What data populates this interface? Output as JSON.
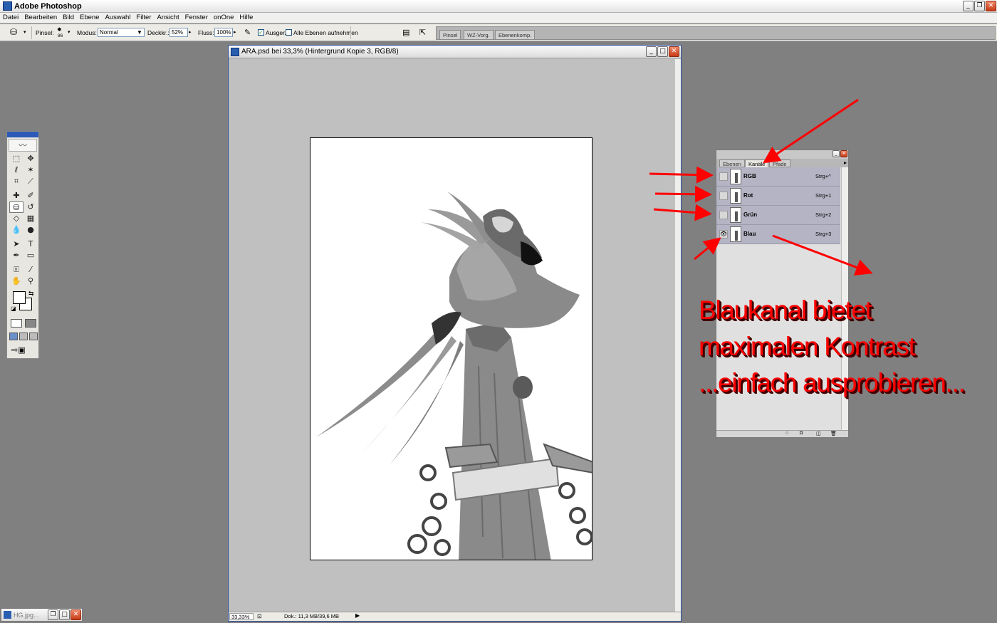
{
  "app": {
    "title": "Adobe Photoshop"
  },
  "menu": [
    "Datei",
    "Bearbeiten",
    "Bild",
    "Ebene",
    "Auswahl",
    "Filter",
    "Ansicht",
    "Fenster",
    "onOne",
    "Hilfe"
  ],
  "options": {
    "brush_label": "Pinsel:",
    "brush_size": "86",
    "mode_label": "Modus:",
    "mode_value": "Normal",
    "opacity_label": "Deckkr.:",
    "opacity_value": "52%",
    "flow_label": "Fluss:",
    "flow_value": "100%",
    "aligned_label": "Ausger.",
    "all_layers_label": "Alle Ebenen aufnehmen"
  },
  "palette_well": [
    "Pinsel",
    "WZ-Vorg.",
    "Ebenenkomp."
  ],
  "document": {
    "title": "ARA.psd bei 33,3% (Hintergrund Kopie 3, RGB/8)",
    "zoom": "33,33%",
    "doc_info": "Dok.: 11,3 MB/39,6 MB"
  },
  "channels_palette": {
    "tabs": [
      "Ebenen",
      "Kanäle",
      "Pfade"
    ],
    "active_tab": "Kanäle",
    "channels": [
      {
        "name": "RGB",
        "shortcut": "Strg+^",
        "visible": false
      },
      {
        "name": "Rot",
        "shortcut": "Strg+1",
        "visible": false
      },
      {
        "name": "Grün",
        "shortcut": "Strg+2",
        "visible": false
      },
      {
        "name": "Blau",
        "shortcut": "Strg+3",
        "visible": true
      }
    ]
  },
  "annotation": {
    "line1": "Blaukanal bietet",
    "line2": "maximalen Kontrast",
    "line3": "...einfach ausprobieren..."
  },
  "minimized_window": {
    "title": "HG.jpg..."
  },
  "colors": {
    "annotation_red": "#ff0000",
    "selection_blue": "#2d59b8"
  }
}
